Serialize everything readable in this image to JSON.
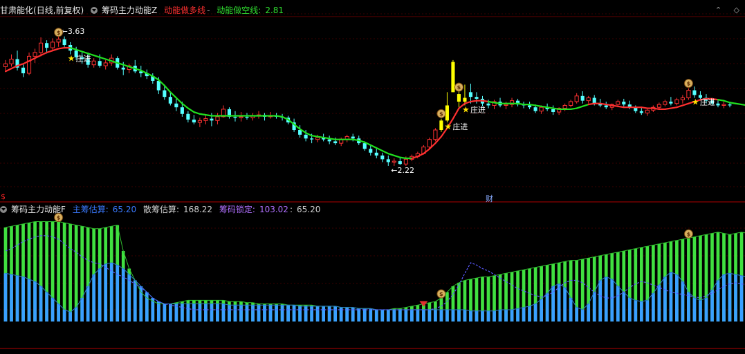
{
  "upper": {
    "stock_name": "甘肃能化",
    "period": "(日线,前复权)",
    "indicator": "筹码主力动能Z",
    "bull_line_label": "动能做多线",
    "bear_line_label": "动能做空线",
    "bear_line_value": "2.81",
    "high_label": "3.63",
    "low_label": "2.22",
    "zhuang_label": "庄进",
    "colors": {
      "up": "#ff3232",
      "down": "#54ffff",
      "bull": "#ff3030",
      "bear": "#20e020",
      "highlight": "#ffff00",
      "label": "#ffffff"
    }
  },
  "lower": {
    "indicator": "筹码主力动能F",
    "main_label": "主筹估算",
    "main_value": "65.20",
    "retail_label": "散筹估算",
    "retail_value": "168.22",
    "locked_label": "筹码锁定",
    "locked_value": "103.02",
    "extra_value": "65.20",
    "cai_label": "财",
    "dollar_label": "$",
    "colors": {
      "green": "#40e040",
      "blue": "#3aa0ff",
      "dashed": "#5a5aff",
      "text_blue": "#3a7aff",
      "text_white": "#d0d0d0",
      "text_purple": "#b070ff"
    }
  },
  "win_ctrl": [
    "⌃",
    "◇"
  ],
  "chart_data": {
    "type": "candlestick",
    "ylim": [
      2.0,
      3.8
    ],
    "grid": true,
    "title": "",
    "candles": [
      [
        3.27,
        3.34,
        3.23,
        3.3
      ],
      [
        3.3,
        3.4,
        3.27,
        3.35
      ],
      [
        3.35,
        3.44,
        3.23,
        3.26
      ],
      [
        3.26,
        3.3,
        3.16,
        3.2
      ],
      [
        3.2,
        3.42,
        3.18,
        3.38
      ],
      [
        3.38,
        3.46,
        3.31,
        3.42
      ],
      [
        3.42,
        3.58,
        3.38,
        3.52
      ],
      [
        3.52,
        3.55,
        3.41,
        3.47
      ],
      [
        3.47,
        3.57,
        3.44,
        3.53
      ],
      [
        3.53,
        3.63,
        3.48,
        3.56
      ],
      [
        3.56,
        3.59,
        3.48,
        3.5
      ],
      [
        3.5,
        3.53,
        3.4,
        3.44
      ],
      [
        3.44,
        3.48,
        3.34,
        3.37
      ],
      [
        3.37,
        3.42,
        3.3,
        3.35
      ],
      [
        3.35,
        3.42,
        3.26,
        3.29
      ],
      [
        3.29,
        3.36,
        3.26,
        3.33
      ],
      [
        3.33,
        3.4,
        3.26,
        3.28
      ],
      [
        3.28,
        3.34,
        3.24,
        3.31
      ],
      [
        3.31,
        3.4,
        3.28,
        3.36
      ],
      [
        3.36,
        3.38,
        3.24,
        3.26
      ],
      [
        3.26,
        3.32,
        3.18,
        3.24
      ],
      [
        3.24,
        3.3,
        3.2,
        3.28
      ],
      [
        3.28,
        3.34,
        3.2,
        3.22
      ],
      [
        3.22,
        3.28,
        3.16,
        3.2
      ],
      [
        3.2,
        3.24,
        3.14,
        3.17
      ],
      [
        3.17,
        3.2,
        3.09,
        3.12
      ],
      [
        3.12,
        3.16,
        2.98,
        3.02
      ],
      [
        3.02,
        3.08,
        2.92,
        2.95
      ],
      [
        2.95,
        3.0,
        2.86,
        2.88
      ],
      [
        2.88,
        2.94,
        2.8,
        2.84
      ],
      [
        2.84,
        2.9,
        2.74,
        2.77
      ],
      [
        2.77,
        2.8,
        2.68,
        2.71
      ],
      [
        2.71,
        2.76,
        2.66,
        2.68
      ],
      [
        2.68,
        2.73,
        2.63,
        2.7
      ],
      [
        2.7,
        2.76,
        2.66,
        2.72
      ],
      [
        2.72,
        2.78,
        2.64,
        2.7
      ],
      [
        2.7,
        2.78,
        2.66,
        2.74
      ],
      [
        2.74,
        2.86,
        2.73,
        2.82
      ],
      [
        2.82,
        2.84,
        2.72,
        2.74
      ],
      [
        2.74,
        2.8,
        2.69,
        2.73
      ],
      [
        2.73,
        2.79,
        2.69,
        2.74
      ],
      [
        2.74,
        2.78,
        2.71,
        2.73
      ],
      [
        2.73,
        2.78,
        2.7,
        2.75
      ],
      [
        2.75,
        2.8,
        2.72,
        2.76
      ],
      [
        2.76,
        2.78,
        2.7,
        2.74
      ],
      [
        2.74,
        2.79,
        2.72,
        2.75
      ],
      [
        2.75,
        2.78,
        2.72,
        2.74
      ],
      [
        2.74,
        2.77,
        2.7,
        2.73
      ],
      [
        2.73,
        2.75,
        2.66,
        2.68
      ],
      [
        2.68,
        2.72,
        2.58,
        2.6
      ],
      [
        2.6,
        2.65,
        2.52,
        2.55
      ],
      [
        2.55,
        2.6,
        2.48,
        2.51
      ],
      [
        2.51,
        2.56,
        2.46,
        2.5
      ],
      [
        2.5,
        2.55,
        2.47,
        2.52
      ],
      [
        2.52,
        2.56,
        2.48,
        2.5
      ],
      [
        2.5,
        2.54,
        2.45,
        2.48
      ],
      [
        2.48,
        2.52,
        2.44,
        2.46
      ],
      [
        2.46,
        2.52,
        2.43,
        2.5
      ],
      [
        2.5,
        2.55,
        2.47,
        2.53
      ],
      [
        2.53,
        2.56,
        2.48,
        2.51
      ],
      [
        2.51,
        2.54,
        2.44,
        2.46
      ],
      [
        2.46,
        2.48,
        2.38,
        2.4
      ],
      [
        2.4,
        2.44,
        2.33,
        2.36
      ],
      [
        2.36,
        2.4,
        2.3,
        2.33
      ],
      [
        2.33,
        2.36,
        2.26,
        2.29
      ],
      [
        2.29,
        2.33,
        2.22,
        2.26
      ],
      [
        2.26,
        2.3,
        2.22,
        2.27
      ],
      [
        2.27,
        2.31,
        2.23,
        2.24
      ],
      [
        2.24,
        2.32,
        2.22,
        2.29
      ],
      [
        2.29,
        2.34,
        2.27,
        2.32
      ],
      [
        2.32,
        2.37,
        2.3,
        2.35
      ],
      [
        2.35,
        2.44,
        2.34,
        2.42
      ],
      [
        2.42,
        2.52,
        2.4,
        2.5
      ],
      [
        2.5,
        2.62,
        2.48,
        2.6
      ],
      [
        2.6,
        2.72,
        2.58,
        2.7
      ],
      [
        2.7,
        3.0,
        2.68,
        2.86
      ],
      [
        3.0,
        3.34,
        3.0,
        3.32
      ],
      [
        2.98,
        3.1,
        2.84,
        2.9
      ],
      [
        2.9,
        3.08,
        2.86,
        2.94
      ],
      [
        3.0,
        3.09,
        2.88,
        2.95
      ],
      [
        2.95,
        3.0,
        2.88,
        2.93
      ],
      [
        2.93,
        2.96,
        2.85,
        2.88
      ],
      [
        2.88,
        2.92,
        2.83,
        2.86
      ],
      [
        2.86,
        2.92,
        2.82,
        2.9
      ],
      [
        2.9,
        2.94,
        2.84,
        2.86
      ],
      [
        2.86,
        2.9,
        2.82,
        2.87
      ],
      [
        2.87,
        2.94,
        2.84,
        2.91
      ],
      [
        2.91,
        2.93,
        2.85,
        2.87
      ],
      [
        2.87,
        2.9,
        2.83,
        2.86
      ],
      [
        2.86,
        2.9,
        2.82,
        2.84
      ],
      [
        2.84,
        2.87,
        2.78,
        2.8
      ],
      [
        2.8,
        2.86,
        2.77,
        2.84
      ],
      [
        2.84,
        2.88,
        2.8,
        2.82
      ],
      [
        2.82,
        2.86,
        2.76,
        2.79
      ],
      [
        2.79,
        2.84,
        2.76,
        2.83
      ],
      [
        2.83,
        2.88,
        2.8,
        2.86
      ],
      [
        2.86,
        2.92,
        2.84,
        2.9
      ],
      [
        2.9,
        2.99,
        2.88,
        2.96
      ],
      [
        2.96,
        3.01,
        2.88,
        2.91
      ],
      [
        2.91,
        2.96,
        2.88,
        2.94
      ],
      [
        2.94,
        2.97,
        2.86,
        2.88
      ],
      [
        2.88,
        2.93,
        2.84,
        2.86
      ],
      [
        2.86,
        2.9,
        2.82,
        2.84
      ],
      [
        2.84,
        2.88,
        2.81,
        2.87
      ],
      [
        2.87,
        2.92,
        2.84,
        2.9
      ],
      [
        2.9,
        2.93,
        2.85,
        2.87
      ],
      [
        2.87,
        2.91,
        2.82,
        2.84
      ],
      [
        2.84,
        2.86,
        2.78,
        2.8
      ],
      [
        2.8,
        2.84,
        2.76,
        2.78
      ],
      [
        2.78,
        2.82,
        2.75,
        2.81
      ],
      [
        2.81,
        2.86,
        2.79,
        2.84
      ],
      [
        2.84,
        2.89,
        2.82,
        2.87
      ],
      [
        2.87,
        2.92,
        2.85,
        2.9
      ],
      [
        2.9,
        2.95,
        2.86,
        2.88
      ],
      [
        2.88,
        2.94,
        2.86,
        2.92
      ],
      [
        2.92,
        2.97,
        2.88,
        2.94
      ],
      [
        2.94,
        3.04,
        2.92,
        3.02
      ],
      [
        3.02,
        3.06,
        2.94,
        2.97
      ],
      [
        2.97,
        3.01,
        2.91,
        2.94
      ],
      [
        2.94,
        2.98,
        2.88,
        2.91
      ],
      [
        2.91,
        2.94,
        2.86,
        2.88
      ],
      [
        2.88,
        2.91,
        2.84,
        2.86
      ],
      [
        2.86,
        2.9,
        2.83,
        2.87
      ],
      [
        2.87,
        2.9,
        2.84,
        2.86
      ]
    ],
    "bull_bear_line": [
      3.22,
      3.25,
      3.28,
      3.3,
      3.33,
      3.36,
      3.39,
      3.42,
      3.44,
      3.46,
      3.47,
      3.47,
      3.45,
      3.43,
      3.41,
      3.39,
      3.37,
      3.35,
      3.33,
      3.31,
      3.29,
      3.27,
      3.25,
      3.23,
      3.2,
      3.17,
      3.13,
      3.07,
      3.0,
      2.94,
      2.88,
      2.83,
      2.79,
      2.77,
      2.76,
      2.75,
      2.75,
      2.75,
      2.75,
      2.75,
      2.75,
      2.75,
      2.75,
      2.75,
      2.75,
      2.75,
      2.75,
      2.74,
      2.71,
      2.66,
      2.61,
      2.57,
      2.54,
      2.53,
      2.52,
      2.51,
      2.5,
      2.5,
      2.5,
      2.5,
      2.49,
      2.47,
      2.44,
      2.41,
      2.38,
      2.35,
      2.33,
      2.31,
      2.3,
      2.3,
      2.32,
      2.35,
      2.4,
      2.46,
      2.53,
      2.62,
      2.72,
      2.83,
      2.88,
      2.9,
      2.91,
      2.91,
      2.9,
      2.89,
      2.88,
      2.88,
      2.88,
      2.88,
      2.87,
      2.87,
      2.86,
      2.85,
      2.84,
      2.83,
      2.82,
      2.82,
      2.82,
      2.83,
      2.85,
      2.87,
      2.88,
      2.88,
      2.87,
      2.86,
      2.85,
      2.84,
      2.84,
      2.84,
      2.84,
      2.83,
      2.83,
      2.82,
      2.82,
      2.83,
      2.84,
      2.86,
      2.88,
      2.9,
      2.92,
      2.93,
      2.93,
      2.92,
      2.91,
      2.89,
      2.88,
      2.87,
      2.86
    ],
    "bull_bear_state": [
      1,
      1,
      1,
      1,
      1,
      1,
      1,
      1,
      1,
      1,
      1,
      1,
      0,
      0,
      0,
      0,
      0,
      0,
      0,
      0,
      0,
      0,
      0,
      0,
      0,
      0,
      0,
      0,
      0,
      0,
      0,
      0,
      0,
      0,
      0,
      0,
      0,
      0,
      0,
      0,
      0,
      0,
      0,
      0,
      0,
      0,
      0,
      0,
      0,
      0,
      0,
      0,
      0,
      0,
      0,
      0,
      0,
      0,
      0,
      0,
      0,
      0,
      0,
      0,
      0,
      0,
      0,
      0,
      0,
      0,
      1,
      1,
      1,
      1,
      1,
      1,
      1,
      1,
      1,
      1,
      1,
      1,
      1,
      0,
      0,
      0,
      0,
      0,
      0,
      0,
      0,
      0,
      0,
      0,
      0,
      0,
      0,
      0,
      0,
      0,
      1,
      1,
      1,
      1,
      1,
      1,
      1,
      1,
      1,
      1,
      1,
      1,
      1,
      1,
      1,
      1,
      1,
      1,
      1,
      1,
      1,
      1,
      0,
      0,
      0,
      0,
      0
    ],
    "highlight_bars": [
      74,
      75,
      76,
      77,
      78
    ],
    "markers": [
      {
        "type": "moneybag",
        "index": 9
      },
      {
        "type": "star",
        "index": 11
      },
      {
        "type": "moneybag",
        "index": 74
      },
      {
        "type": "star",
        "index": 75
      },
      {
        "type": "moneybag",
        "index": 77
      },
      {
        "type": "star",
        "index": 78
      },
      {
        "type": "moneybag",
        "index": 116
      },
      {
        "type": "star",
        "index": 117
      }
    ],
    "lower_panel": {
      "ylim": [
        0,
        180
      ],
      "green_top": [
        160,
        162,
        164,
        166,
        168,
        170,
        170,
        170,
        170,
        170,
        168,
        166,
        164,
        162,
        160,
        158,
        158,
        160,
        162,
        164,
        120,
        90,
        70,
        50,
        40,
        35,
        30,
        30,
        30,
        32,
        34,
        36,
        36,
        36,
        36,
        36,
        36,
        36,
        34,
        34,
        34,
        32,
        32,
        30,
        30,
        30,
        30,
        30,
        28,
        28,
        28,
        28,
        28,
        26,
        26,
        26,
        26,
        24,
        24,
        24,
        22,
        22,
        22,
        20,
        20,
        20,
        22,
        22,
        24,
        26,
        28,
        30,
        32,
        34,
        40,
        50,
        60,
        66,
        70,
        72,
        74,
        76,
        76,
        78,
        80,
        82,
        84,
        86,
        88,
        90,
        92,
        94,
        96,
        98,
        100,
        102,
        104,
        104,
        106,
        108,
        110,
        112,
        114,
        116,
        118,
        120,
        122,
        124,
        126,
        128,
        130,
        132,
        134,
        136,
        138,
        140,
        142,
        144,
        146,
        148,
        150,
        152,
        150,
        148,
        150,
        152,
        150
      ],
      "blue_top": [
        82,
        80,
        78,
        76,
        72,
        68,
        60,
        50,
        40,
        30,
        20,
        16,
        24,
        40,
        60,
        80,
        90,
        98,
        100,
        96,
        90,
        80,
        70,
        60,
        50,
        40,
        34,
        30,
        30,
        30,
        30,
        30,
        30,
        30,
        30,
        30,
        30,
        30,
        28,
        28,
        28,
        28,
        28,
        28,
        28,
        28,
        28,
        28,
        28,
        28,
        26,
        26,
        26,
        26,
        26,
        26,
        26,
        24,
        24,
        24,
        22,
        22,
        22,
        20,
        20,
        20,
        20,
        20,
        20,
        20,
        20,
        20,
        20,
        20,
        20,
        20,
        20,
        20,
        20,
        18,
        18,
        18,
        18,
        18,
        20,
        20,
        20,
        22,
        24,
        26,
        30,
        38,
        48,
        60,
        64,
        58,
        40,
        24,
        20,
        30,
        50,
        70,
        76,
        72,
        60,
        50,
        40,
        36,
        34,
        36,
        48,
        62,
        76,
        84,
        80,
        68,
        50,
        40,
        36,
        40,
        54,
        70,
        80,
        82,
        80,
        78,
        76
      ],
      "dashed": [
        120,
        124,
        130,
        136,
        140,
        144,
        146,
        146,
        144,
        140,
        132,
        124,
        118,
        110,
        104,
        100,
        98,
        92,
        86,
        80,
        76,
        70,
        64,
        58,
        50,
        40,
        34,
        30,
        28,
        26,
        24,
        22,
        20,
        20,
        20,
        20,
        20,
        20,
        20,
        20,
        20,
        20,
        20,
        20,
        20,
        20,
        20,
        20,
        20,
        20,
        20,
        20,
        20,
        20,
        20,
        20,
        20,
        20,
        20,
        20,
        20,
        20,
        20,
        20,
        20,
        20,
        20,
        20,
        20,
        20,
        20,
        20,
        20,
        22,
        26,
        34,
        46,
        62,
        82,
        100,
        96,
        90,
        86,
        80,
        74,
        68,
        62,
        56,
        52,
        48,
        44,
        42,
        44,
        50,
        58,
        66,
        70,
        70,
        66,
        58,
        50,
        44,
        40,
        40,
        44,
        50,
        58,
        64,
        68,
        66,
        62,
        58,
        54,
        50,
        48,
        46,
        44,
        42,
        40,
        44,
        48,
        54,
        60,
        64,
        66,
        64,
        62
      ]
    }
  }
}
